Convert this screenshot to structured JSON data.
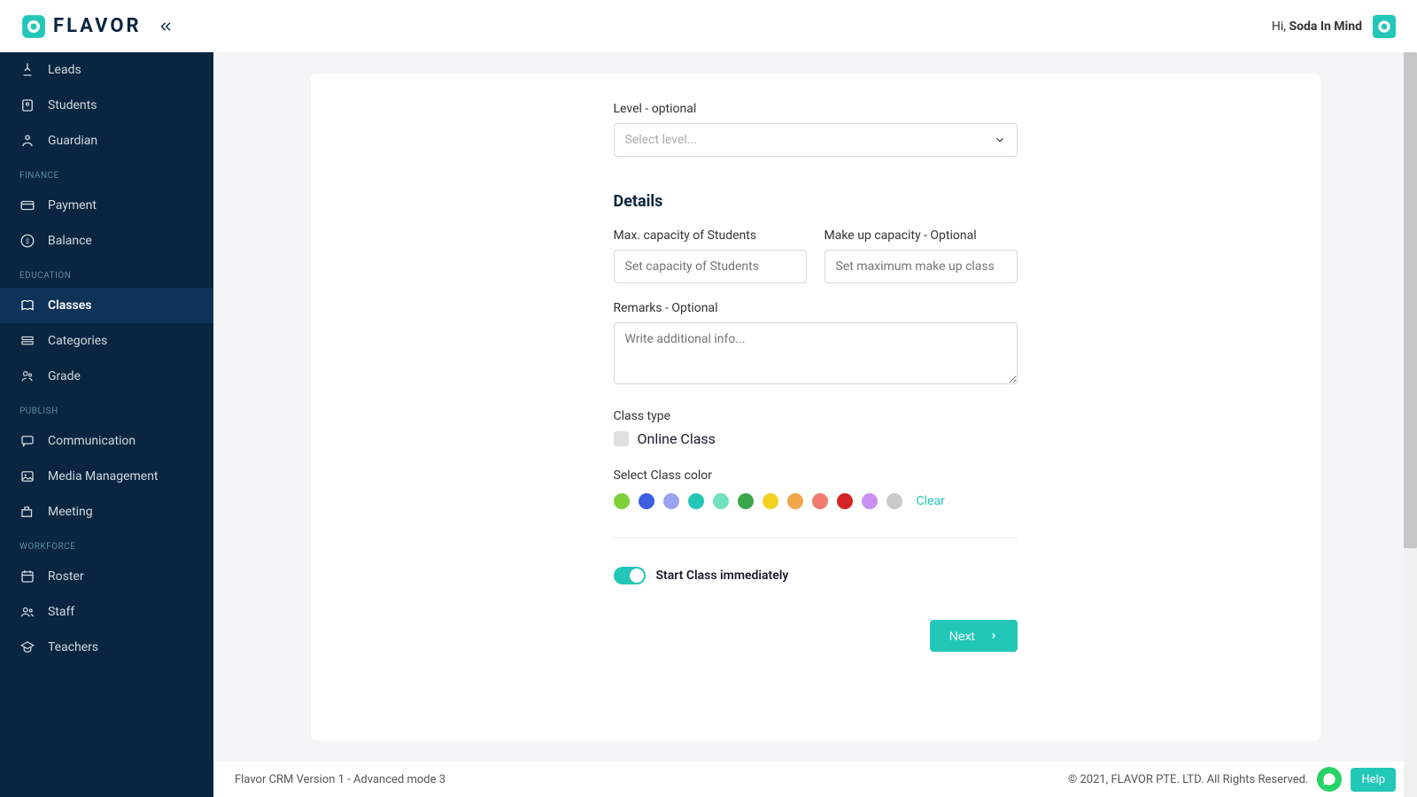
{
  "brand": {
    "name": "FLAVOR"
  },
  "header": {
    "greeting_prefix": "Hi, ",
    "user_name": "Soda In Mind"
  },
  "sidebar": {
    "sections": [
      {
        "items": [
          {
            "label": "Leads",
            "icon": "leads"
          },
          {
            "label": "Students",
            "icon": "students"
          },
          {
            "label": "Guardian",
            "icon": "guardian"
          }
        ]
      },
      {
        "title": "FINANCE",
        "items": [
          {
            "label": "Payment",
            "icon": "payment"
          },
          {
            "label": "Balance",
            "icon": "balance"
          }
        ]
      },
      {
        "title": "EDUCATION",
        "items": [
          {
            "label": "Classes",
            "icon": "classes",
            "active": true
          },
          {
            "label": "Categories",
            "icon": "categories"
          },
          {
            "label": "Grade",
            "icon": "grade"
          }
        ]
      },
      {
        "title": "PUBLISH",
        "items": [
          {
            "label": "Communication",
            "icon": "communication"
          },
          {
            "label": "Media Management",
            "icon": "media"
          },
          {
            "label": "Meeting",
            "icon": "meeting"
          }
        ]
      },
      {
        "title": "WORKFORCE",
        "items": [
          {
            "label": "Roster",
            "icon": "roster"
          },
          {
            "label": "Staff",
            "icon": "staff"
          },
          {
            "label": "Teachers",
            "icon": "teachers"
          }
        ]
      }
    ]
  },
  "form": {
    "level_label": "Level - optional",
    "level_placeholder": "Select level...",
    "details_heading": "Details",
    "max_capacity_label": "Max. capacity of Students",
    "max_capacity_placeholder": "Set capacity of Students",
    "makeup_label": "Make up capacity - Optional",
    "makeup_placeholder": "Set maximum make up class",
    "remarks_label": "Remarks - Optional",
    "remarks_placeholder": "Write additional info...",
    "class_type_label": "Class type",
    "online_class_label": "Online Class",
    "color_label": "Select Class color",
    "colors": [
      "#7fd13b",
      "#3b5ee3",
      "#9aa3f0",
      "#23c7b7",
      "#6fe2c0",
      "#3aa74c",
      "#f3d123",
      "#f0a64a",
      "#f27a6f",
      "#d62323",
      "#c98ef0",
      "#c9c9c9"
    ],
    "clear_label": "Clear",
    "start_toggle_label": "Start Class immediately",
    "next_button": "Next"
  },
  "footer": {
    "version": "Flavor CRM Version 1 - Advanced mode 3",
    "copyright": "© 2021, FLAVOR PTE. LTD. All Rights Reserved.",
    "help_label": "Help"
  }
}
